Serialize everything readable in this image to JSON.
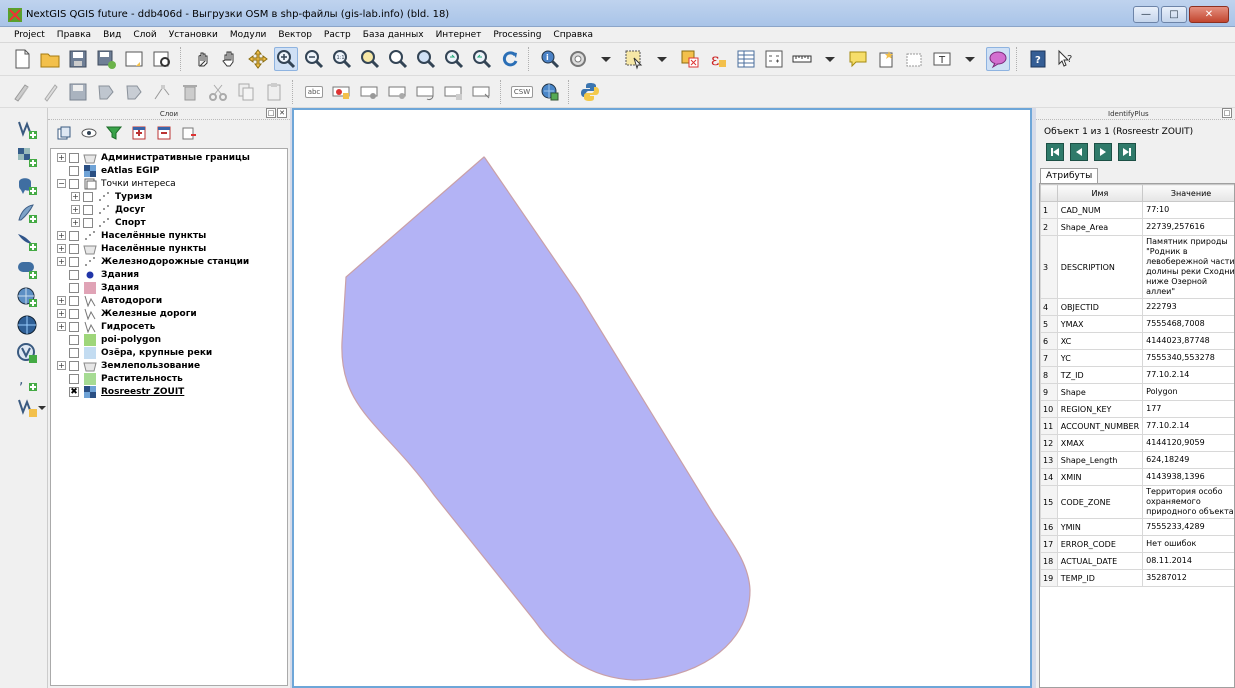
{
  "window": {
    "title": "NextGIS QGIS future - ddb406d - Выгрузки OSM в shp-файлы (gis-lab.info) (bld. 18)"
  },
  "menu": [
    "Project",
    "Правка",
    "Вид",
    "Слой",
    "Установки",
    "Модули",
    "Вектор",
    "Растр",
    "База данных",
    "Интернет",
    "Processing",
    "Справка"
  ],
  "toolbar2_labels": {
    "csw": "CSW",
    "abc": "abc"
  },
  "layers_panel": {
    "title": "Слои",
    "layers": [
      {
        "name": "Административные границы",
        "bold": true,
        "indent": 0,
        "expander": "+",
        "icon": "polygon-icon"
      },
      {
        "name": "eAtlas EGIP",
        "bold": true,
        "indent": 0,
        "expander": "",
        "icon": "raster-icon"
      },
      {
        "name": "Точки интереса",
        "bold": false,
        "indent": 0,
        "expander": "-",
        "icon": "group-icon"
      },
      {
        "name": "Туризм",
        "bold": true,
        "indent": 1,
        "expander": "+",
        "icon": "point-icon"
      },
      {
        "name": "Досуг",
        "bold": true,
        "indent": 1,
        "expander": "+",
        "icon": "point-icon"
      },
      {
        "name": "Спорт",
        "bold": true,
        "indent": 1,
        "expander": "+",
        "icon": "point-icon"
      },
      {
        "name": "Населённые пункты",
        "bold": true,
        "indent": 0,
        "expander": "+",
        "icon": "point-icon"
      },
      {
        "name": "Населённые пункты",
        "bold": true,
        "indent": 0,
        "expander": "+",
        "icon": "polygon-icon"
      },
      {
        "name": "Железнодорожные станции",
        "bold": true,
        "indent": 0,
        "expander": "+",
        "icon": "point-icon"
      },
      {
        "name": "Здания",
        "bold": true,
        "indent": 0,
        "expander": "",
        "icon": "blue-dot-icon"
      },
      {
        "name": "Здания",
        "bold": true,
        "indent": 0,
        "expander": "",
        "icon": "pink-fill-icon"
      },
      {
        "name": "Автодороги",
        "bold": true,
        "indent": 0,
        "expander": "+",
        "icon": "line-icon"
      },
      {
        "name": "Железные дороги",
        "bold": true,
        "indent": 0,
        "expander": "+",
        "icon": "line-icon"
      },
      {
        "name": "Гидросеть",
        "bold": true,
        "indent": 0,
        "expander": "+",
        "icon": "line-icon"
      },
      {
        "name": "poi-polygon",
        "bold": true,
        "indent": 0,
        "expander": "",
        "icon": "green-fill-icon"
      },
      {
        "name": "Озёра, крупные реки",
        "bold": true,
        "indent": 0,
        "expander": "",
        "icon": "lightblue-fill-icon"
      },
      {
        "name": "Землепользование",
        "bold": true,
        "indent": 0,
        "expander": "+",
        "icon": "polygon-icon"
      },
      {
        "name": "Растительность",
        "bold": true,
        "indent": 0,
        "expander": "",
        "icon": "lightgreen-fill-icon"
      },
      {
        "name": "Rosreestr ZOUIT",
        "bold": true,
        "indent": 0,
        "expander": "",
        "icon": "raster-icon",
        "checked": true,
        "selected": true
      }
    ]
  },
  "identify_panel": {
    "title": "IdentifyPlus",
    "feature_count": "Объект 1 из 1 (Rosreestr ZOUIT)",
    "tab": "Атрибуты",
    "col_name": "Имя",
    "col_value": "Значение",
    "rows": [
      {
        "idx": "1",
        "name": "CAD_NUM",
        "value": "77:10"
      },
      {
        "idx": "2",
        "name": "Shape_Area",
        "value": "22739,257616"
      },
      {
        "idx": "3",
        "name": "DESCRIPTION",
        "value": "Памятник природы \"Родник в левобережной части долины реки Сходни ниже Озерной аллеи\""
      },
      {
        "idx": "4",
        "name": "OBJECTID",
        "value": "222793"
      },
      {
        "idx": "5",
        "name": "YMAX",
        "value": "7555468,7008"
      },
      {
        "idx": "6",
        "name": "XC",
        "value": "4144023,87748"
      },
      {
        "idx": "7",
        "name": "YC",
        "value": "7555340,553278"
      },
      {
        "idx": "8",
        "name": "TZ_ID",
        "value": "77.10.2.14"
      },
      {
        "idx": "9",
        "name": "Shape",
        "value": "Polygon"
      },
      {
        "idx": "10",
        "name": "REGION_KEY",
        "value": "177"
      },
      {
        "idx": "11",
        "name": "ACCOUNT_NUMBER",
        "value": "77.10.2.14"
      },
      {
        "idx": "12",
        "name": "XMAX",
        "value": "4144120,9059"
      },
      {
        "idx": "13",
        "name": "Shape_Length",
        "value": "624,18249"
      },
      {
        "idx": "14",
        "name": "XMIN",
        "value": "4143938,1396"
      },
      {
        "idx": "15",
        "name": "CODE_ZONE",
        "value": "Территория особо охраняемого природного объекта"
      },
      {
        "idx": "16",
        "name": "YMIN",
        "value": "7555233,4289"
      },
      {
        "idx": "17",
        "name": "ERROR_CODE",
        "value": "Нет ошибок"
      },
      {
        "idx": "18",
        "name": "ACTUAL_DATE",
        "value": "08.11.2014"
      },
      {
        "idx": "19",
        "name": "TEMP_ID",
        "value": "35287012"
      }
    ]
  },
  "colors": {
    "polygon_fill": "#b3b3f5",
    "polygon_stroke": "#c9a0a8",
    "map_border": "#6ea6d8"
  }
}
